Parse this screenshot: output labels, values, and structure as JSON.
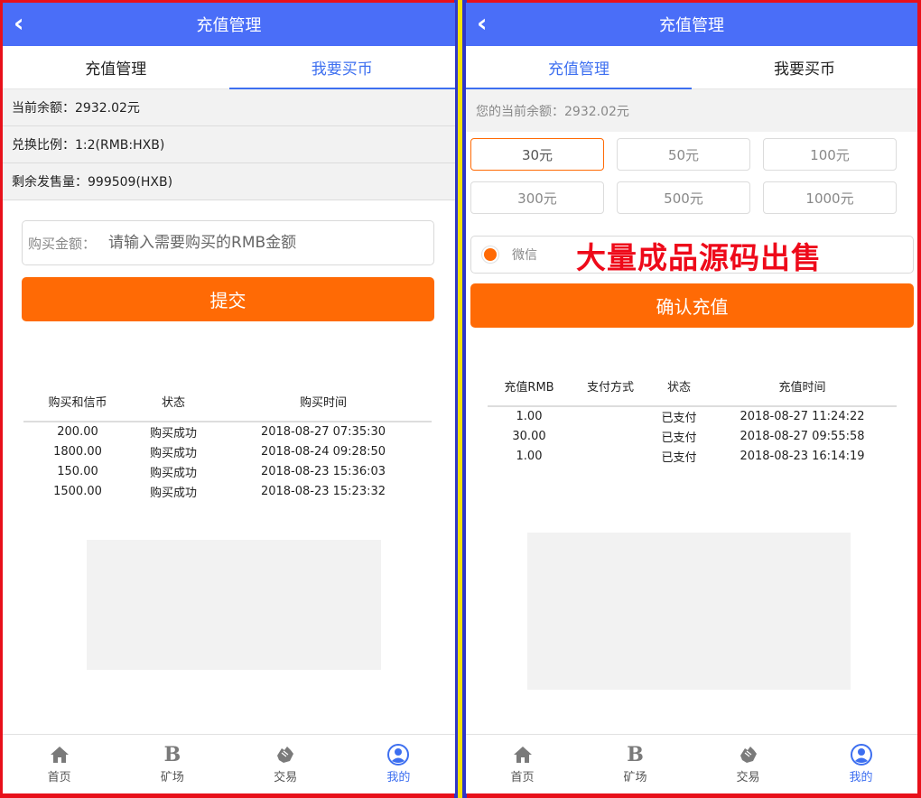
{
  "left": {
    "header": {
      "back_label": "‹",
      "title": "充值管理"
    },
    "tabs": [
      {
        "label": "充值管理"
      },
      {
        "label": "我要买币"
      }
    ],
    "info": {
      "balance": "当前余额：2932.02元",
      "ratio": "兑换比例：1:2(RMB:HXB)",
      "remaining": "剩余发售量：999509(HXB)"
    },
    "form": {
      "label": "购买金额：",
      "placeholder": "请输入需要购买的RMB金额",
      "submit_label": "提交"
    },
    "table": {
      "headers": [
        "购买和信币",
        "状态",
        "购买时间"
      ],
      "rows": [
        [
          "200.00",
          "购买成功",
          "2018-08-27 07:35:30"
        ],
        [
          "1800.00",
          "购买成功",
          "2018-08-24 09:28:50"
        ],
        [
          "150.00",
          "购买成功",
          "2018-08-23 15:36:03"
        ],
        [
          "1500.00",
          "购买成功",
          "2018-08-23 15:23:32"
        ]
      ]
    }
  },
  "right": {
    "header": {
      "back_label": "‹",
      "title": "充值管理"
    },
    "tabs": [
      {
        "label": "充值管理"
      },
      {
        "label": "我要买币"
      }
    ],
    "balance": "您的当前余额：2932.02元",
    "amounts": [
      "30元",
      "50元",
      "100元",
      "300元",
      "500元",
      "1000元"
    ],
    "payment": {
      "label": "微信"
    },
    "promo": "大量成品源码出售",
    "confirm_label": "确认充值",
    "table": {
      "headers": [
        "充值RMB",
        "支付方式",
        "状态",
        "充值时间"
      ],
      "rows": [
        [
          "1.00",
          "",
          "已支付",
          "2018-08-27 11:24:22"
        ],
        [
          "30.00",
          "",
          "已支付",
          "2018-08-27 09:55:58"
        ],
        [
          "1.00",
          "",
          "已支付",
          "2018-08-23 16:14:19"
        ]
      ]
    }
  },
  "nav": [
    {
      "label": "首页",
      "icon": "home-icon"
    },
    {
      "label": "矿场",
      "icon": "b-letter-icon",
      "glyph": "B"
    },
    {
      "label": "交易",
      "icon": "handshake-icon"
    },
    {
      "label": "我的",
      "icon": "user-circle-icon"
    }
  ],
  "colors": {
    "header": "#4a6ef8",
    "accent": "#3d6ff0",
    "orange": "#ff6a05",
    "promo": "#ee0a1a",
    "frame_red": "#e8101a",
    "divider_blue": "#2f36c8",
    "divider_yellow": "#f4e20a"
  }
}
